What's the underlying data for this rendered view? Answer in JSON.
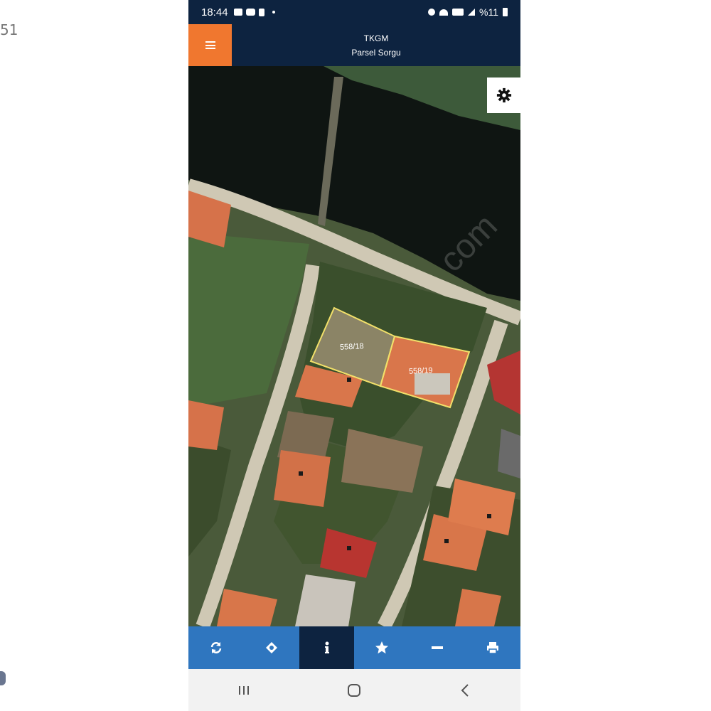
{
  "edge": {
    "left_text": "51"
  },
  "status_bar": {
    "time": "18:44",
    "battery_text": "%11",
    "left_icons": [
      "gallery-icon",
      "youtube-icon",
      "clipboard-icon",
      "dot-icon"
    ],
    "right_icons": [
      "alarm-icon",
      "wifi-icon",
      "volte-icon",
      "signal-icon",
      "battery-icon"
    ]
  },
  "header": {
    "title": "TKGM",
    "subtitle": "Parsel Sorgu",
    "menu_icon": "hamburger-icon"
  },
  "map": {
    "settings_icon": "gear-icon",
    "parcels": [
      {
        "label": "558/18"
      },
      {
        "label": "558/19"
      }
    ],
    "watermark": "com"
  },
  "toolbar": {
    "buttons": [
      {
        "name": "refresh",
        "icon": "refresh-icon",
        "active": false
      },
      {
        "name": "locate",
        "icon": "locate-icon",
        "active": false
      },
      {
        "name": "info",
        "icon": "info-icon",
        "active": true
      },
      {
        "name": "favorite",
        "icon": "star-icon",
        "active": false
      },
      {
        "name": "measure",
        "icon": "minus-icon",
        "active": false
      },
      {
        "name": "print",
        "icon": "print-icon",
        "active": false
      }
    ]
  },
  "android_nav": {
    "buttons": [
      "recents-icon",
      "home-icon",
      "back-icon"
    ]
  },
  "colors": {
    "header_bg": "#0d2340",
    "menu_accent": "#f0772f",
    "toolbar_bg": "#2f76bf",
    "toolbar_active": "#0d2340",
    "parcel_outline": "#f2e06a"
  }
}
